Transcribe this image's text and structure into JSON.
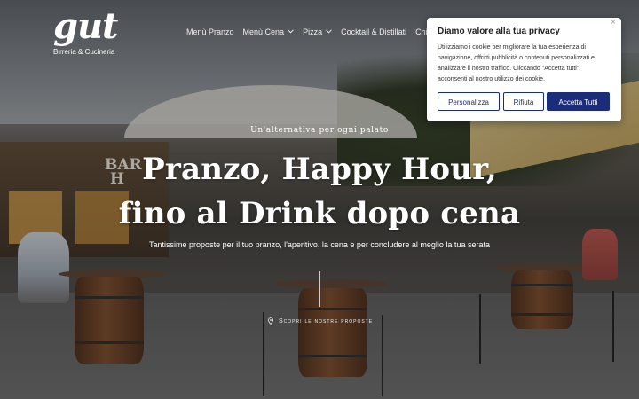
{
  "brand": {
    "logo_text": "gut",
    "subtitle": "Birreria & Cucineria"
  },
  "nav": {
    "items": [
      {
        "label": "Menù Pranzo",
        "has_dropdown": false
      },
      {
        "label": "Menù Cena",
        "has_dropdown": true
      },
      {
        "label": "Pizza",
        "has_dropdown": true
      },
      {
        "label": "Cocktail & Distillati",
        "has_dropdown": false
      },
      {
        "label": "Chi Siamo",
        "has_dropdown": false
      }
    ]
  },
  "hero": {
    "tagline": "Un'alternativa per ogni palato",
    "headline_line1": "Pranzo, Happy Hour,",
    "headline_line2": "fino al Drink dopo cena",
    "subline": "Tantissime proposte per il tuo pranzo, l'aperitivo, la cena e per concludere al meglio la tua serata",
    "cta_label": "Scopri le nostre proposte",
    "kiosk_sign_line1": "BAR",
    "kiosk_sign_line2": "H"
  },
  "cookie_banner": {
    "title": "Diamo valore alla tua privacy",
    "body": "Utilizziamo i cookie per migliorare la tua esperienza di navigazione, offrirti pubblicità o contenuti personalizzati e analizzare il nostro traffico. Cliccando \"Accetta tutti\", acconsenti al nostro utilizzo dei cookie.",
    "close_symbol": "×",
    "buttons": {
      "customize": "Personalizza",
      "reject": "Rifiuta",
      "accept": "Accetta Tutti"
    },
    "accent_color": "#1b2d7a"
  },
  "icons": {
    "location": "location-pin-icon",
    "dropdown": "chevron-down-icon",
    "close": "close-icon"
  }
}
